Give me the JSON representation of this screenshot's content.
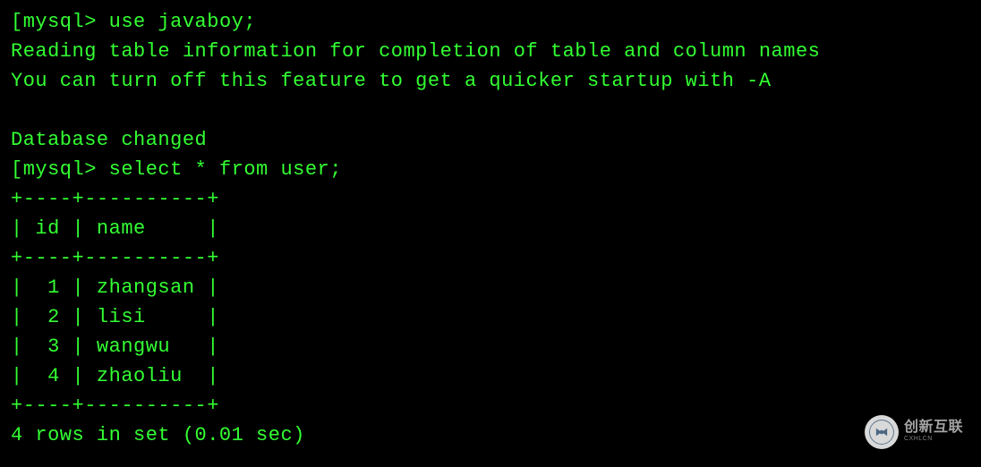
{
  "terminal": {
    "prompt": "mysql> ",
    "bracket_open": "[",
    "commands": [
      "use javaboy;",
      "select * from user;"
    ],
    "messages": {
      "reading": "Reading table information for completion of table and column names",
      "turnoff": "You can turn off this feature to get a quicker startup with -A",
      "changed": "Database changed"
    },
    "table": {
      "border": "+----+----------+",
      "header": "| id | name     |",
      "rows": [
        "|  1 | zhangsan |",
        "|  2 | lisi     |",
        "|  3 | wangwu   |",
        "|  4 | zhaoliu  |"
      ],
      "columns": [
        "id",
        "name"
      ],
      "data": [
        {
          "id": 1,
          "name": "zhangsan"
        },
        {
          "id": 2,
          "name": "lisi"
        },
        {
          "id": 3,
          "name": "wangwu"
        },
        {
          "id": 4,
          "name": "zhaoliu"
        }
      ]
    },
    "footer": "4 rows in set (0.01 sec)"
  },
  "watermark": {
    "icon_letter": "Ⓧ",
    "text": "创新互联",
    "sub": "CXHLCN"
  }
}
